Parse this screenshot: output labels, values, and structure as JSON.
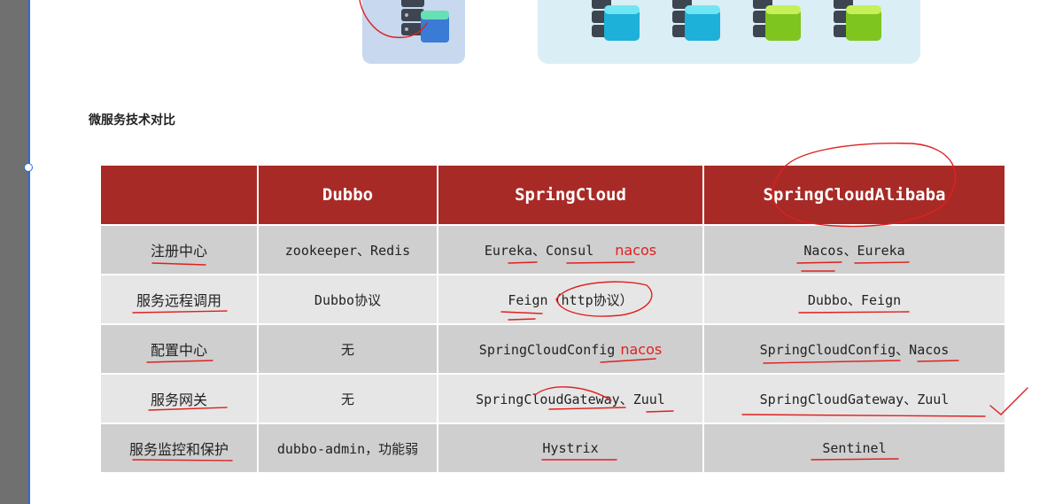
{
  "section_heading": "微服务技术对比",
  "table": {
    "headers": [
      "",
      "Dubbo",
      "SpringCloud",
      "SpringCloudAlibaba"
    ],
    "rows": [
      {
        "label": "注册中心",
        "dubbo": "zookeeper、Redis",
        "springcloud": "Eureka、Consul",
        "note": "nacos",
        "alibaba": "Nacos、Eureka"
      },
      {
        "label": "服务远程调用",
        "dubbo": "Dubbo协议",
        "springcloud": "Feign（http协议）",
        "note": "",
        "alibaba": "Dubbo、Feign"
      },
      {
        "label": "配置中心",
        "dubbo": "无",
        "springcloud": "SpringCloudConfig",
        "note": "nacos",
        "alibaba": "SpringCloudConfig、Nacos"
      },
      {
        "label": "服务网关",
        "dubbo": "无",
        "springcloud": "SpringCloudGateway、Zuul",
        "note": "",
        "alibaba": "SpringCloudGateway、Zuul"
      },
      {
        "label": "服务监控和保护",
        "dubbo": "dubbo-admin，功能弱",
        "springcloud": "Hystrix",
        "note": "",
        "alibaba": "Sentinel"
      }
    ]
  },
  "colors": {
    "header_bg": "#a82a26",
    "annotation": "#e02020",
    "row_dark": "#cfcfcf",
    "row_light": "#e6e6e6"
  },
  "icons": [
    "server-stack-icon",
    "database-icon"
  ]
}
